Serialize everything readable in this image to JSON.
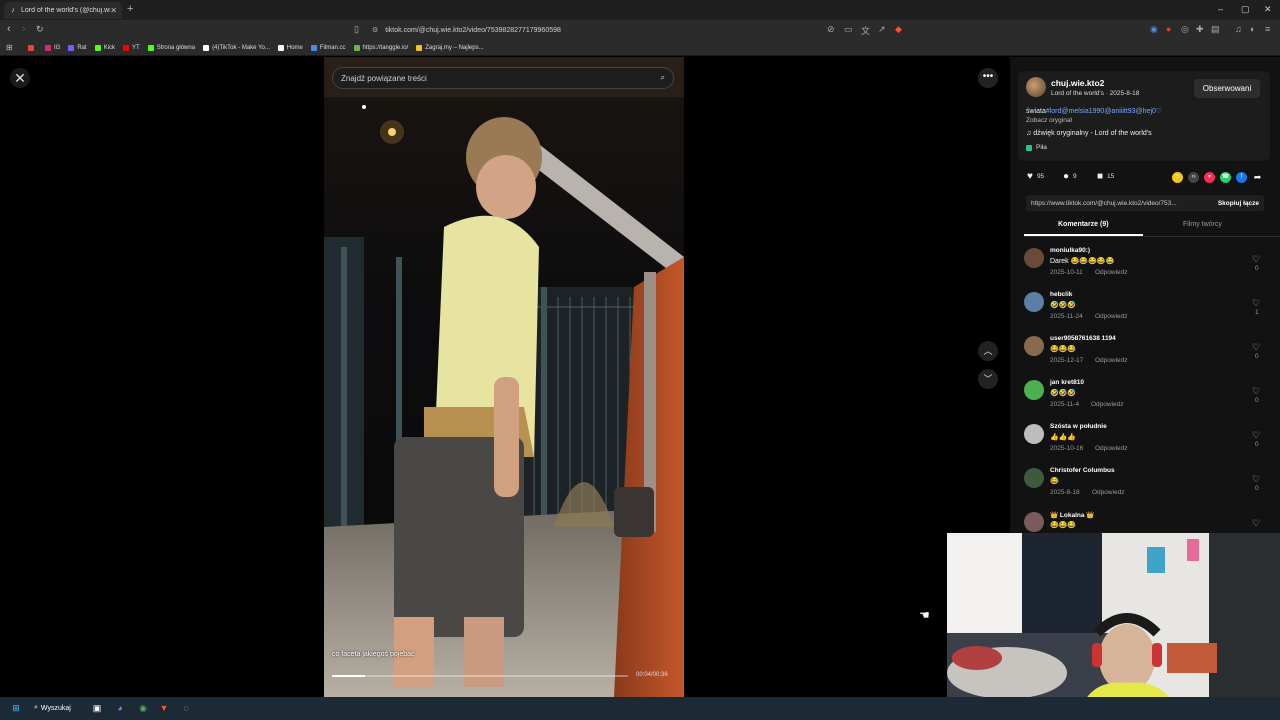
{
  "browser": {
    "tab_title": "Lord of the world's (@chuj.wi",
    "tab_close": "✕",
    "new_tab": "+",
    "url": "tiktok.com/@chuj.wie.kto2/video/7539828277179960598",
    "bookmarks": [
      {
        "label": "",
        "color": "#ea4335"
      },
      {
        "label": "IG",
        "color": "#d62976"
      },
      {
        "label": "Rat",
        "color": "#7b5cff"
      },
      {
        "label": "Kick",
        "color": "#53fc18"
      },
      {
        "label": "YT",
        "color": "#ff0000"
      },
      {
        "label": "Strona główna",
        "color": "#53fc18"
      },
      {
        "label": "(4)TikTok - Make Yo...",
        "color": "#ffffff"
      },
      {
        "label": "Home",
        "color": "#ffffff"
      },
      {
        "label": "Filman.cc",
        "color": "#4a90e2"
      },
      {
        "label": "https://tanggle.io/",
        "color": "#6ab04c"
      },
      {
        "label": "Zagraj.my – Najleps...",
        "color": "#f0c419"
      }
    ]
  },
  "player": {
    "search_placeholder": "Znajdź powiązane treści",
    "caption": "co faceta jakiegoś pojebać",
    "time": "00:04/00:36",
    "progress": 0.11
  },
  "creator": {
    "username": "chuj.wie.kto2",
    "subline": "Lord of the world's · 2025-8-18",
    "follow_label": "Obserwowani",
    "desc_prefix": "świata",
    "desc_tags": "#lord@melsia1990@aniiitt93@hej0♡",
    "see_original": "Zobacz oryginał",
    "music": "dźwięk oryginalny - Lord of the world's",
    "tag": "Piła"
  },
  "stats": {
    "likes": "95",
    "comments": "9",
    "saves": "15"
  },
  "share_colors": [
    "#f5c518",
    "#444444",
    "#fe2c55",
    "#25d366",
    "#1877f2"
  ],
  "link": {
    "url": "https://www.tiktok.com/@chuj.wie.kto2/video/753...",
    "copy_label": "Skopiuj łącze"
  },
  "tabs": {
    "comments": "Komentarze (9)",
    "creator_videos": "Filmy twórcy"
  },
  "comments": [
    {
      "name": "moniulka90:)",
      "text": "Darek 😂😂😂😂😂",
      "date": "2025-10-11",
      "reply": "Odpowiedz",
      "likes": "0",
      "avatar": "#6b4a3a"
    },
    {
      "name": "hebclik",
      "text": "🤣🤣🤣",
      "date": "2025-11-24",
      "reply": "Odpowiedz",
      "likes": "1",
      "avatar": "#5c7fa8"
    },
    {
      "name": "user9058761638 1194",
      "text": "😂😂😂",
      "date": "2025-12-17",
      "reply": "Odpowiedz",
      "likes": "0",
      "avatar": "#8a6a4a"
    },
    {
      "name": "jan kret810",
      "text": "🤣🤣🤣",
      "date": "2025-11-4",
      "reply": "Odpowiedz",
      "likes": "0",
      "avatar": "#4caf50"
    },
    {
      "name": "Szósta w południe",
      "text": "👍👍👍",
      "date": "2025-10-16",
      "reply": "Odpowiedz",
      "likes": "0",
      "avatar": "#bdbdbd"
    },
    {
      "name": "Christofer Columbus",
      "text": "😂",
      "date": "2025-8-18",
      "reply": "Odpowiedz",
      "likes": "0",
      "avatar": "#3d5a3d"
    },
    {
      "name": "👑 Lokalna 👑",
      "text": "😂😂😂",
      "date": "",
      "reply": "",
      "likes": "",
      "avatar": "#7a5a5a"
    }
  ],
  "taskbar": {
    "search_label": "Wyszukaj"
  }
}
